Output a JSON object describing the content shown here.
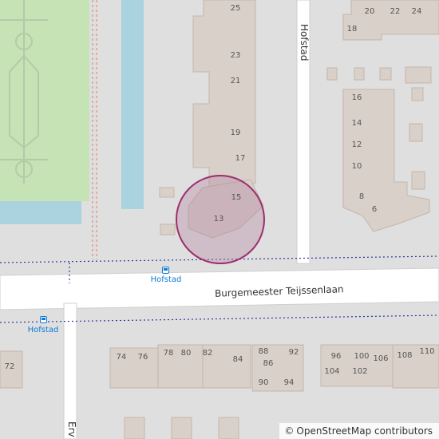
{
  "map": {
    "roads": [
      {
        "id": "burgemeester-teijssenlaan",
        "name": "Burgemeester Teijssenlaan"
      },
      {
        "id": "hofstad",
        "name": "Hofstad"
      },
      {
        "id": "erv",
        "name": "Erv"
      }
    ],
    "bus_stops": [
      {
        "id": "north",
        "name": "Hofstad"
      },
      {
        "id": "south",
        "name": "Hofstad"
      }
    ],
    "house_numbers": [
      "25",
      "23",
      "21",
      "19",
      "17",
      "15",
      "13",
      "20",
      "22",
      "24",
      "18",
      "16",
      "14",
      "12",
      "10",
      "8",
      "6",
      "72",
      "74",
      "76",
      "78",
      "80",
      "82",
      "84",
      "88",
      "86",
      "90",
      "92",
      "94",
      "96",
      "100",
      "104",
      "102",
      "106",
      "108",
      "110"
    ],
    "highlighted_house": "13",
    "colors": {
      "background": "#e0dfdf",
      "building": "#d9d0c9",
      "building_outline": "#c4b6ab",
      "grass": "#c6e3b5",
      "water": "#aad3df",
      "road": "#ffffff",
      "transit_line": "#2b3a9e",
      "highlight_fill": "#b07d9e",
      "highlight_stroke": "#9b2f6e",
      "bus_stop": "#0a7bd6"
    }
  },
  "attribution": {
    "symbol": "©",
    "text": "OpenStreetMap contributors"
  }
}
